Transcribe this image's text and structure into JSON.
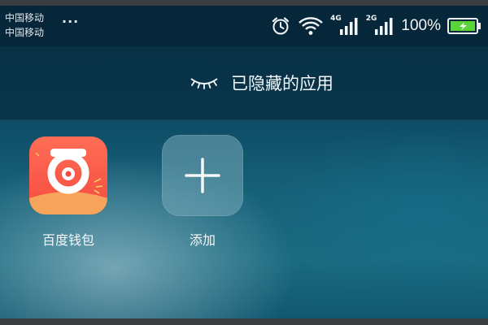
{
  "status_bar": {
    "carrier_1": "中国移动",
    "carrier_2": "中国移动",
    "more": "···",
    "network_1": "4G",
    "network_2": "2G",
    "battery": "100%",
    "icons": [
      "alarm-icon",
      "wifi-icon",
      "signal-icon",
      "signal-icon",
      "battery-icon"
    ],
    "battery_color": "#5bd43a"
  },
  "header": {
    "title": "已隐藏的应用",
    "icon": "closed-eye-icon"
  },
  "apps": [
    {
      "label": "百度钱包",
      "icon": "baidu-wallet-icon",
      "color": "#f54b3f"
    },
    {
      "label": "添加",
      "icon": "plus-icon"
    }
  ]
}
